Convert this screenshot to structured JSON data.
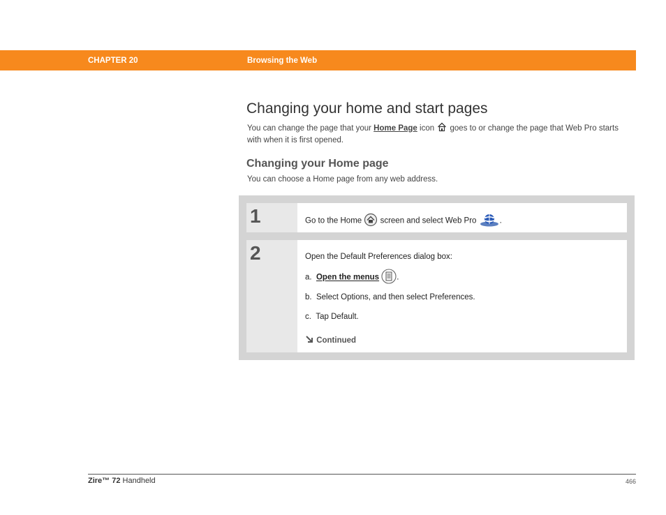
{
  "header": {
    "chapter": "CHAPTER 20",
    "section": "Browsing the Web",
    "bar_color": "#f7891d"
  },
  "page": {
    "title": "Changing your home and start pages",
    "intro_before": "You can change the page that your ",
    "intro_link": "Home Page",
    "intro_mid": " icon ",
    "intro_after": " goes to or change the page that Web Pro starts with when it is first opened.",
    "subtitle": "Changing your Home page",
    "subtext": "You can choose a Home page from any web address."
  },
  "steps": [
    {
      "number": "1",
      "text_before": "Go to the Home ",
      "text_mid": " screen and select Web Pro ",
      "text_after": "."
    },
    {
      "number": "2",
      "intro": "Open the Default Preferences dialog box:",
      "items": [
        {
          "prefix": "a.",
          "link": "Open the menus",
          "suffix": "."
        },
        {
          "prefix": "b.",
          "text": "Select Options, and then select Preferences."
        },
        {
          "prefix": "c.",
          "text": "Tap Default."
        }
      ],
      "continued": "Continued"
    }
  ],
  "footer": {
    "product_bold": "Zire™ 72",
    "product_rest": " Handheld",
    "page_number": "466"
  },
  "icons": [
    "home-page-icon",
    "home-screen-icon",
    "web-pro-icon",
    "menu-icon",
    "continued-arrow-icon"
  ]
}
